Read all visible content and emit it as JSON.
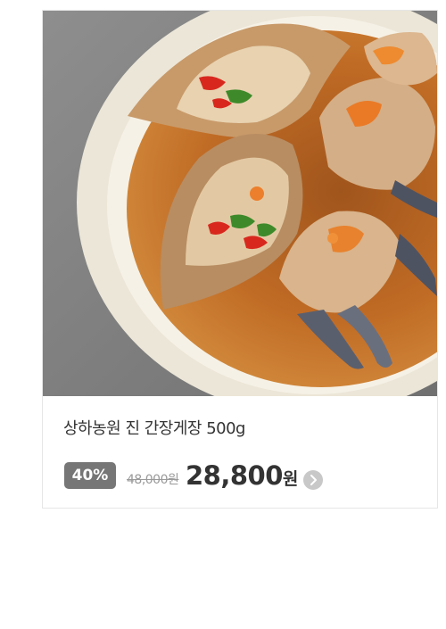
{
  "product": {
    "name": "상하농원 진 간장게장 500g",
    "discount_badge": "40%",
    "original_price": "48,000원",
    "sale_price_value": "28,800",
    "sale_price_unit": "원",
    "detail_icon": "chevron-right-icon",
    "image_subject": "soy-sauce-marinated-crab-dish"
  },
  "colors": {
    "badge_bg": "#767676",
    "text_primary": "#333333",
    "text_strike": "#9a9a9a",
    "arrow_bg": "#c8c8c8",
    "card_border": "#e6e6e6"
  }
}
